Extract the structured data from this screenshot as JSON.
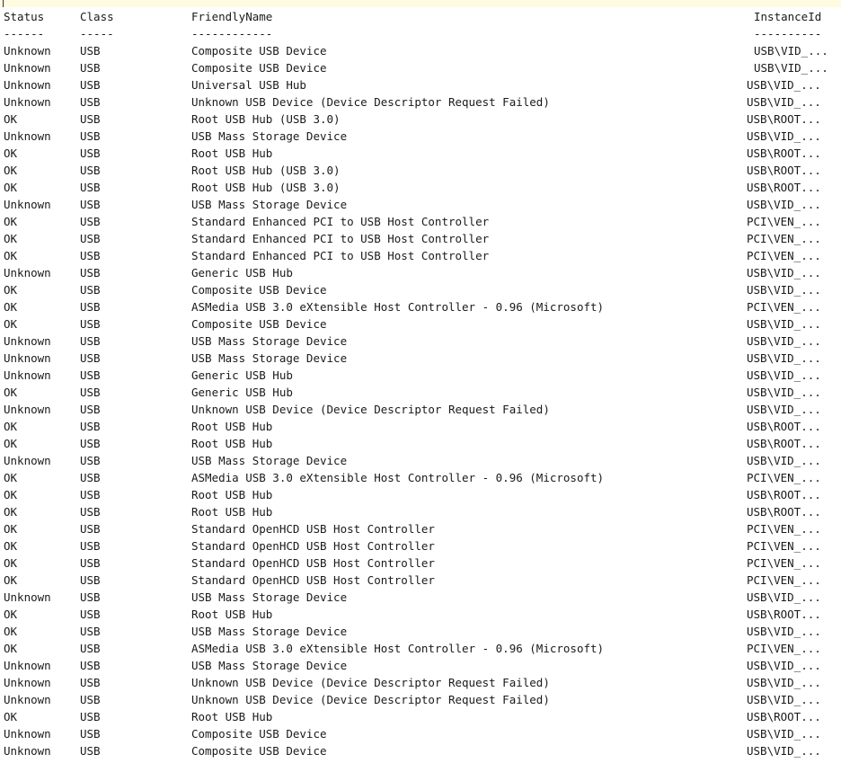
{
  "headers": {
    "status": "Status",
    "class": "Class",
    "name": "FriendlyName",
    "id": "InstanceId"
  },
  "separators": {
    "status": "------",
    "class": "-----",
    "name": "------------",
    "id": "----------"
  },
  "rows": [
    {
      "status": "Unknown",
      "class": "USB",
      "name": "Composite USB Device",
      "id": "USB\\VID_...",
      "id_indent": true
    },
    {
      "status": "Unknown",
      "class": "USB",
      "name": "Composite USB Device",
      "id": "USB\\VID_...",
      "id_indent": true
    },
    {
      "status": "Unknown",
      "class": "USB",
      "name": "Universal USB Hub",
      "id": "USB\\VID_..."
    },
    {
      "status": "Unknown",
      "class": "USB",
      "name": "Unknown USB Device (Device Descriptor Request Failed)",
      "id": "USB\\VID_..."
    },
    {
      "status": "OK",
      "class": "USB",
      "name": "Root USB Hub (USB 3.0)",
      "id": "USB\\ROOT..."
    },
    {
      "status": "Unknown",
      "class": "USB",
      "name": "USB Mass Storage Device",
      "id": "USB\\VID_..."
    },
    {
      "status": "OK",
      "class": "USB",
      "name": "Root USB Hub",
      "id": "USB\\ROOT..."
    },
    {
      "status": "OK",
      "class": "USB",
      "name": "Root USB Hub (USB 3.0)",
      "id": "USB\\ROOT..."
    },
    {
      "status": "OK",
      "class": "USB",
      "name": "Root USB Hub (USB 3.0)",
      "id": "USB\\ROOT..."
    },
    {
      "status": "Unknown",
      "class": "USB",
      "name": "USB Mass Storage Device",
      "id": "USB\\VID_..."
    },
    {
      "status": "OK",
      "class": "USB",
      "name": "Standard Enhanced PCI to USB Host Controller",
      "id": "PCI\\VEN_..."
    },
    {
      "status": "OK",
      "class": "USB",
      "name": "Standard Enhanced PCI to USB Host Controller",
      "id": "PCI\\VEN_..."
    },
    {
      "status": "OK",
      "class": "USB",
      "name": "Standard Enhanced PCI to USB Host Controller",
      "id": "PCI\\VEN_..."
    },
    {
      "status": "Unknown",
      "class": "USB",
      "name": "Generic USB Hub",
      "id": "USB\\VID_..."
    },
    {
      "status": "OK",
      "class": "USB",
      "name": "Composite USB Device",
      "id": "USB\\VID_..."
    },
    {
      "status": "OK",
      "class": "USB",
      "name": "ASMedia USB 3.0 eXtensible Host Controller - 0.96 (Microsoft)",
      "id": "PCI\\VEN_..."
    },
    {
      "status": "OK",
      "class": "USB",
      "name": "Composite USB Device",
      "id": "USB\\VID_..."
    },
    {
      "status": "Unknown",
      "class": "USB",
      "name": "USB Mass Storage Device",
      "id": "USB\\VID_..."
    },
    {
      "status": "Unknown",
      "class": "USB",
      "name": "USB Mass Storage Device",
      "id": "USB\\VID_..."
    },
    {
      "status": "Unknown",
      "class": "USB",
      "name": "Generic USB Hub",
      "id": "USB\\VID_..."
    },
    {
      "status": "OK",
      "class": "USB",
      "name": "Generic USB Hub",
      "id": "USB\\VID_..."
    },
    {
      "status": "Unknown",
      "class": "USB",
      "name": "Unknown USB Device (Device Descriptor Request Failed)",
      "id": "USB\\VID_..."
    },
    {
      "status": "OK",
      "class": "USB",
      "name": "Root USB Hub",
      "id": "USB\\ROOT..."
    },
    {
      "status": "OK",
      "class": "USB",
      "name": "Root USB Hub",
      "id": "USB\\ROOT..."
    },
    {
      "status": "Unknown",
      "class": "USB",
      "name": "USB Mass Storage Device",
      "id": "USB\\VID_..."
    },
    {
      "status": "OK",
      "class": "USB",
      "name": "ASMedia USB 3.0 eXtensible Host Controller - 0.96 (Microsoft)",
      "id": "PCI\\VEN_..."
    },
    {
      "status": "OK",
      "class": "USB",
      "name": "Root USB Hub",
      "id": "USB\\ROOT..."
    },
    {
      "status": "OK",
      "class": "USB",
      "name": "Root USB Hub",
      "id": "USB\\ROOT..."
    },
    {
      "status": "OK",
      "class": "USB",
      "name": "Standard OpenHCD USB Host Controller",
      "id": "PCI\\VEN_..."
    },
    {
      "status": "OK",
      "class": "USB",
      "name": "Standard OpenHCD USB Host Controller",
      "id": "PCI\\VEN_..."
    },
    {
      "status": "OK",
      "class": "USB",
      "name": "Standard OpenHCD USB Host Controller",
      "id": "PCI\\VEN_..."
    },
    {
      "status": "OK",
      "class": "USB",
      "name": "Standard OpenHCD USB Host Controller",
      "id": "PCI\\VEN_..."
    },
    {
      "status": "Unknown",
      "class": "USB",
      "name": "USB Mass Storage Device",
      "id": "USB\\VID_..."
    },
    {
      "status": "OK",
      "class": "USB",
      "name": "Root USB Hub",
      "id": "USB\\ROOT..."
    },
    {
      "status": "OK",
      "class": "USB",
      "name": "USB Mass Storage Device",
      "id": "USB\\VID_..."
    },
    {
      "status": "OK",
      "class": "USB",
      "name": "ASMedia USB 3.0 eXtensible Host Controller - 0.96 (Microsoft)",
      "id": "PCI\\VEN_..."
    },
    {
      "status": "Unknown",
      "class": "USB",
      "name": "USB Mass Storage Device",
      "id": "USB\\VID_..."
    },
    {
      "status": "Unknown",
      "class": "USB",
      "name": "Unknown USB Device (Device Descriptor Request Failed)",
      "id": "USB\\VID_..."
    },
    {
      "status": "Unknown",
      "class": "USB",
      "name": "Unknown USB Device (Device Descriptor Request Failed)",
      "id": "USB\\VID_..."
    },
    {
      "status": "OK",
      "class": "USB",
      "name": "Root USB Hub",
      "id": "USB\\ROOT..."
    },
    {
      "status": "Unknown",
      "class": "USB",
      "name": "Composite USB Device",
      "id": "USB\\VID_..."
    },
    {
      "status": "Unknown",
      "class": "USB",
      "name": "Composite USB Device",
      "id": "USB\\VID_..."
    }
  ]
}
